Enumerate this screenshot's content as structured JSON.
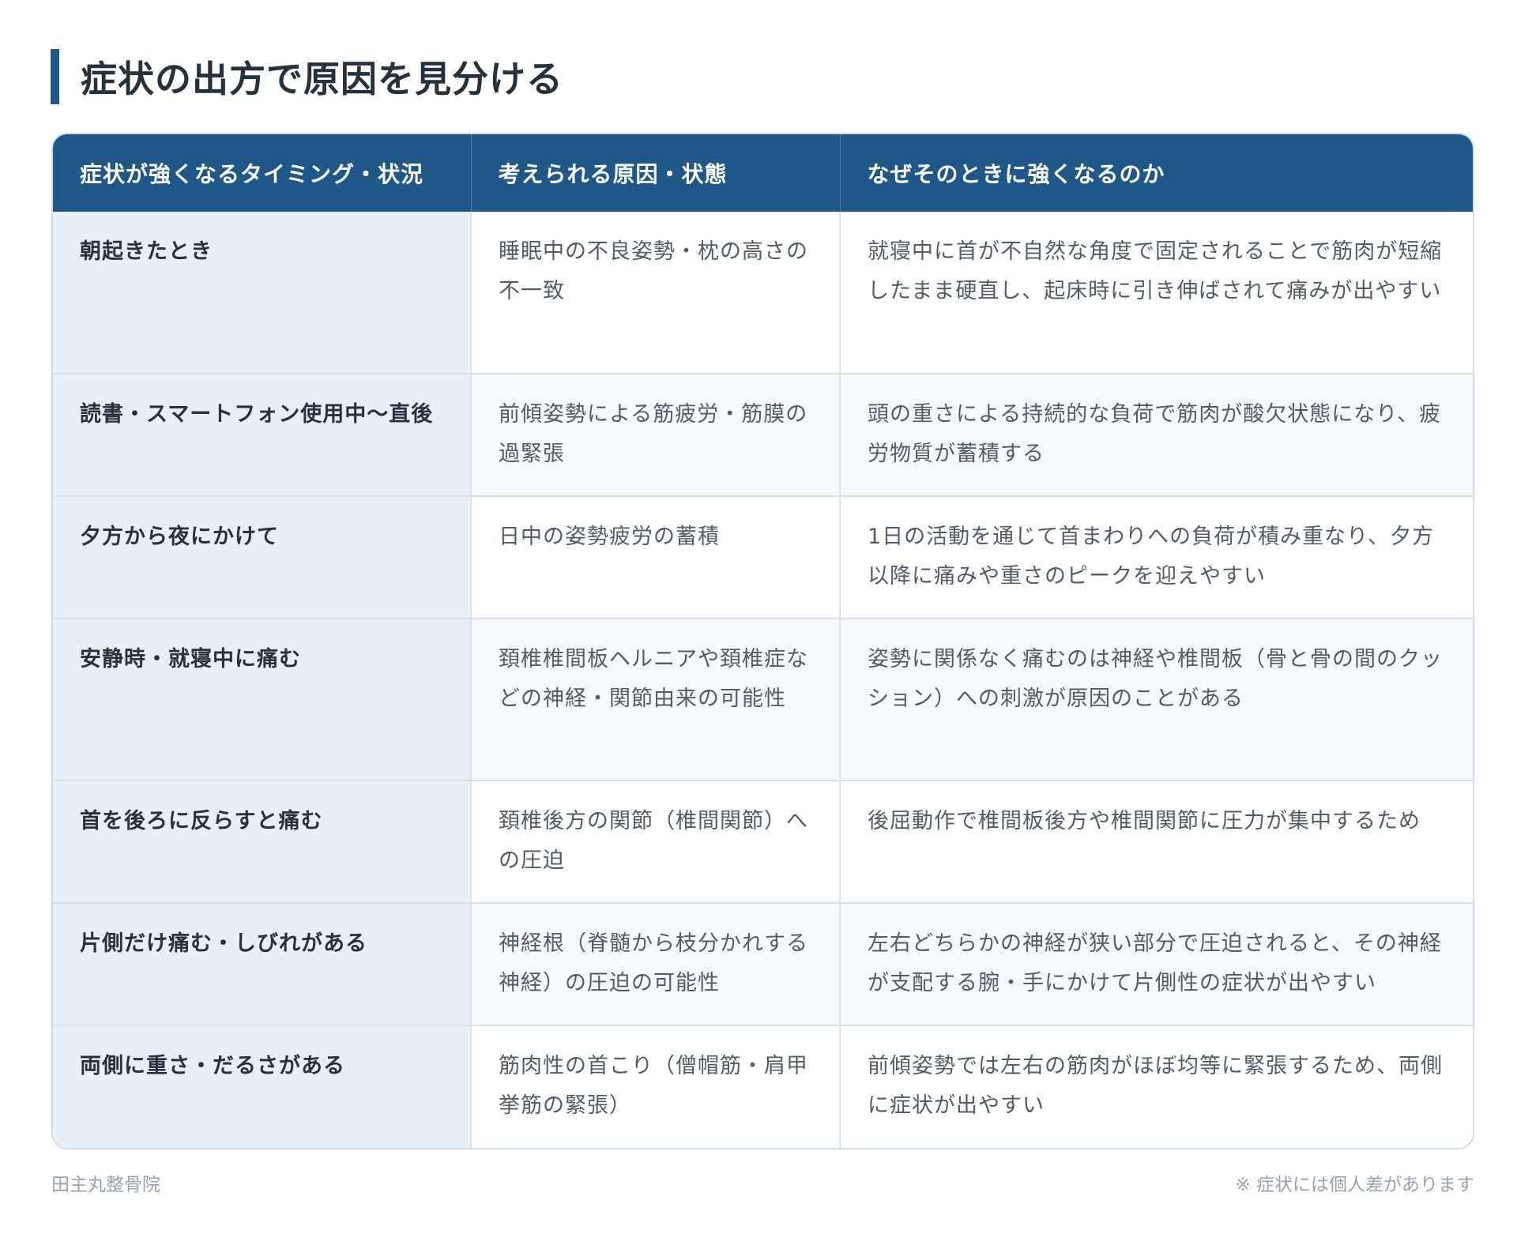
{
  "page": {
    "title": "症状の出方で原因を見分ける"
  },
  "table": {
    "headers": [
      "症状が強くなるタイミング・状況",
      "考えられる原因・状態",
      "なぜそのときに強くなるのか"
    ],
    "rows": [
      {
        "condition": "朝起きたとき",
        "cause": "睡眠中の不良姿勢・枕の高さの不一致",
        "reason": "就寝中に首が不自然な角度で固定されることで筋肉が短縮したまま硬直し、起床時に引き伸ばされて痛みが出やすい"
      },
      {
        "condition": "読書・スマートフォン使用中〜直後",
        "cause": "前傾姿勢による筋疲労・筋膜の過緊張",
        "reason": "頭の重さによる持続的な負荷で筋肉が酸欠状態になり、疲労物質が蓄積する"
      },
      {
        "condition": "夕方から夜にかけて",
        "cause": "日中の姿勢疲労の蓄積",
        "reason": "1日の活動を通じて首まわりへの負荷が積み重なり、夕方以降に痛みや重さのピークを迎えやすい"
      },
      {
        "condition": "安静時・就寝中に痛む",
        "cause": "頚椎椎間板ヘルニアや頚椎症などの神経・関節由来の可能性",
        "reason": "姿勢に関係なく痛むのは神経や椎間板（骨と骨の間のクッション）への刺激が原因のことがある"
      },
      {
        "condition": "首を後ろに反らすと痛む",
        "cause": "頚椎後方の関節（椎間関節）への圧迫",
        "reason": "後屈動作で椎間板後方や椎間関節に圧力が集中するため"
      },
      {
        "condition": "片側だけ痛む・しびれがある",
        "cause": "神経根（脊髄から枝分かれする神経）の圧迫の可能性",
        "reason": "左右どちらかの神経が狭い部分で圧迫されると、その神経が支配する腕・手にかけて片側性の症状が出やすい"
      },
      {
        "condition": "両側に重さ・だるさがある",
        "cause": "筋肉性の首こり（僧帽筋・肩甲挙筋の緊張）",
        "reason": "前傾姿勢では左右の筋肉がほぼ均等に緊張するため、両側に症状が出やすい"
      }
    ]
  },
  "footer": {
    "clinic_name": "田主丸整骨院",
    "note": "※ 症状には個人差があります"
  },
  "colors": {
    "header_bg": "#1e5788",
    "condition_col_bg": "#e8f0f7",
    "border": "#d6e1ea"
  }
}
